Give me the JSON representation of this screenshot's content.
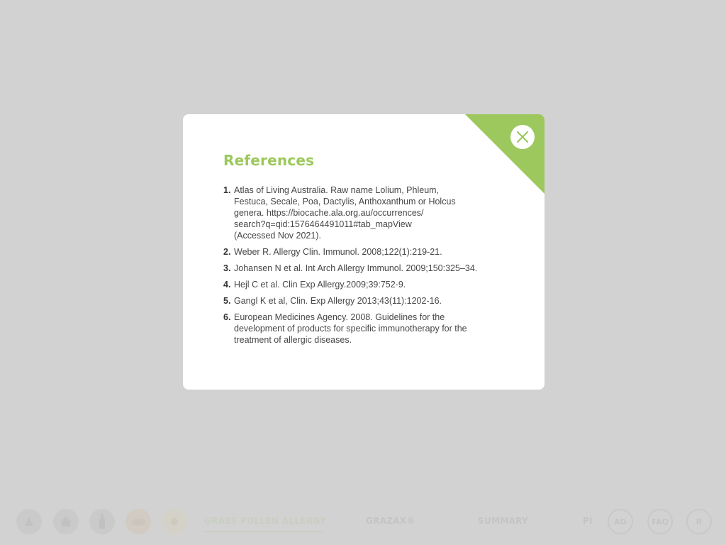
{
  "bottom_nav": {
    "icons": [
      "triangle-icon",
      "home-icon",
      "bottle-icon",
      "grass-cloud-icon",
      "sun-icon"
    ],
    "links": [
      {
        "label": "GRASS POLLEN ALLERGY",
        "active": true
      },
      {
        "label": "GRAZAX®",
        "active": false
      },
      {
        "label": "SUMMARY",
        "active": false
      },
      {
        "label": "PI",
        "active": false
      }
    ],
    "circle_buttons": [
      "AD",
      "FAQ",
      "R"
    ]
  },
  "modal": {
    "title": "References",
    "close_icon": "close-icon",
    "accent_color": "#9cc85d",
    "references": [
      {
        "number": "1.",
        "lines": [
          "Atlas of Living Australia. Raw name Lolium, Phleum,",
          "Festuca, Secale, Poa, Dactylis, Anthoxanthum or Holcus",
          "genera. https://biocache.ala.org.au/occurrences/",
          "search?q=qid:1576464491011#tab_mapView",
          "(Accessed Nov 2021)."
        ]
      },
      {
        "number": "2.",
        "lines": [
          "Weber R. Allergy Clin. Immunol. 2008;122(1):219-21."
        ]
      },
      {
        "number": "3.",
        "lines": [
          "Johansen N et al. Int Arch Allergy Immunol. 2009;150:325–34."
        ]
      },
      {
        "number": "4.",
        "lines": [
          "Hejl C et al. Clin Exp Allergy.2009;39:752-9."
        ]
      },
      {
        "number": "5.",
        "lines": [
          "Gangl K et al, Clin. Exp Allergy 2013;43(11):1202-16."
        ]
      },
      {
        "number": "6.",
        "lines": [
          "European Medicines Agency. 2008. Guidelines for the",
          "development of products for specific immunotherapy for the",
          "treatment of allergic diseases."
        ]
      }
    ]
  }
}
